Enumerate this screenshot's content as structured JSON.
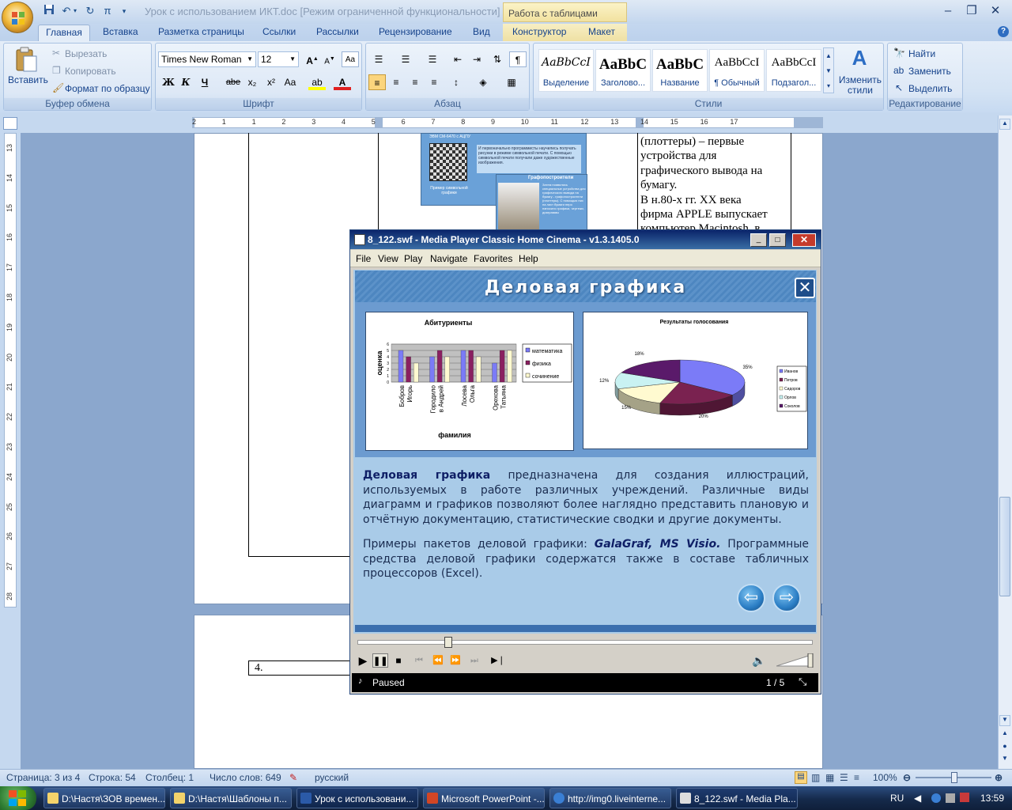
{
  "window": {
    "title": "Урок с использованием ИКТ.doc [Режим ограниченной функциональности] - M",
    "context_group": "Работа с таблицами"
  },
  "tabs": [
    "Главная",
    "Вставка",
    "Разметка страницы",
    "Ссылки",
    "Рассылки",
    "Рецензирование",
    "Вид",
    "Конструктор",
    "Макет"
  ],
  "ribbon": {
    "clipboard": {
      "paste": "Вставить",
      "cut": "Вырезать",
      "copy": "Копировать",
      "format_painter": "Формат по образцу",
      "label": "Буфер обмена"
    },
    "font": {
      "name": "Times New Roman",
      "size": "12",
      "label": "Шрифт",
      "bold": "Ж",
      "italic": "К",
      "underline": "Ч",
      "strike": "abe",
      "sub": "x₂",
      "sup": "x²",
      "case": "Aa",
      "grow": "A",
      "shrink": "A"
    },
    "paragraph": {
      "label": "Абзац"
    },
    "styles": {
      "label": "Стили",
      "tiles": [
        {
          "sample": "AaBbCcI",
          "name": "Выделение"
        },
        {
          "sample": "AaBbC",
          "name": "Заголово..."
        },
        {
          "sample": "AaBbC",
          "name": "Название"
        },
        {
          "sample": "AaBbCcI",
          "name": "¶ Обычный"
        },
        {
          "sample": "AaBbCcI",
          "name": "Подзагол..."
        }
      ],
      "change": "Изменить стили"
    },
    "editing": {
      "find": "Найти",
      "replace": "Заменить",
      "select": "Выделить",
      "label": "Редактирование"
    }
  },
  "ruler": {
    "h_ticks": [
      "2",
      "1",
      "1",
      "2",
      "3",
      "4",
      "5",
      "6",
      "7",
      "8",
      "9",
      "10",
      "11",
      "12",
      "13",
      "14",
      "15",
      "16",
      "17"
    ],
    "v_ticks": [
      "13",
      "14",
      "15",
      "16",
      "17",
      "18",
      "19",
      "20",
      "21",
      "22",
      "23",
      "24",
      "25",
      "26",
      "27",
      "28"
    ]
  },
  "document": {
    "right_col_text": [
      "(плоттеры) – первые",
      "устройства для",
      "графического вывода на",
      "бумагу.",
      "В н.80-х гг. XX века",
      "фирма APPLE выпускает",
      "компьютер Macintosh, в"
    ],
    "thumb1_title": "ЭВМ СМ-6470 с АЦПУ",
    "thumb1_text": "И первоначально программисты научились получать рисунки в режиме символьной печати. С помощью символьной печати получали даже художественные изображения.",
    "thumb1_caption": "Пример символьной графики",
    "thumb2_title": "Графопостроители",
    "thumb2_text": "Затем появились специальные устройства для графического вывода на бумагу - графопостроители (плоттеры). С помощью них на лист бумаги перо наносило графики, чертежи, диаграммы",
    "cell_number": "4."
  },
  "mpc": {
    "title": "8_122.swf - Media Player Classic Home Cinema - v1.3.1405.0",
    "menu": [
      "File",
      "View",
      "Play",
      "Navigate",
      "Favorites",
      "Help"
    ],
    "status": "Paused",
    "counter": "1 / 5",
    "flash": {
      "title": "Деловая графика",
      "p1_bold": "Деловая графика",
      "p1_rest": " предназначена для создания иллюстраций, используемых в работе различных учреждений. Различные виды диаграмм и графиков позволяют более наглядно представить плановую и отчётную документацию, статистические сводки и другие документы.",
      "p2_start": "Примеры пакетов деловой графики: ",
      "p2_bold": "GalaGraf, MS Visio.",
      "p2_rest": " Программные средства деловой графики содержатся также в составе табличных процессоров (Excel)."
    }
  },
  "chart_data": [
    {
      "type": "bar",
      "title": "Абитуриенты",
      "xlabel": "фамилия",
      "ylabel": "оценка",
      "ylim": [
        0,
        6
      ],
      "yticks": [
        "0",
        "1",
        "2",
        "3",
        "4",
        "5",
        "6"
      ],
      "categories": [
        "Бобров Игорь",
        "Городило в Андрей",
        "Лосева Ольга",
        "Орехова Татьяна"
      ],
      "series": [
        {
          "name": "математика",
          "color": "#7b7bf7",
          "values": [
            5,
            4,
            5,
            3
          ]
        },
        {
          "name": "физика",
          "color": "#8a2060",
          "values": [
            4,
            5,
            5,
            5
          ]
        },
        {
          "name": "сочинение",
          "color": "#fffad0",
          "values": [
            3,
            4,
            4,
            5
          ]
        }
      ],
      "legend": "right",
      "grid": true
    },
    {
      "type": "pie",
      "title": "Результаты голосования",
      "labels": [
        "Иванов",
        "Петров",
        "Сидоров",
        "Орлов",
        "Соколов"
      ],
      "values": [
        35,
        20,
        15,
        12,
        18
      ],
      "value_labels": [
        "35%",
        "20%",
        "15%",
        "12%",
        "18%"
      ],
      "colors": [
        "#7b7bf7",
        "#7a2250",
        "#fffad0",
        "#c9f2f2",
        "#5a1a6a"
      ],
      "legend": "right"
    }
  ],
  "status_bar": {
    "page": "Страница: 3 из 4",
    "line": "Строка: 54",
    "col": "Столбец: 1",
    "words": "Число слов: 649",
    "lang": "русский",
    "zoom": "100%"
  },
  "taskbar": {
    "items": [
      {
        "label": "D:\\Настя\\ЗОВ времен..."
      },
      {
        "label": "D:\\Настя\\Шаблоны п..."
      },
      {
        "label": "Урок с использовани..."
      },
      {
        "label": "Microsoft PowerPoint -..."
      },
      {
        "label": "http://img0.liveinterne..."
      },
      {
        "label": "8_122.swf - Media Pla..."
      }
    ],
    "lang": "RU",
    "time": "13:59"
  }
}
